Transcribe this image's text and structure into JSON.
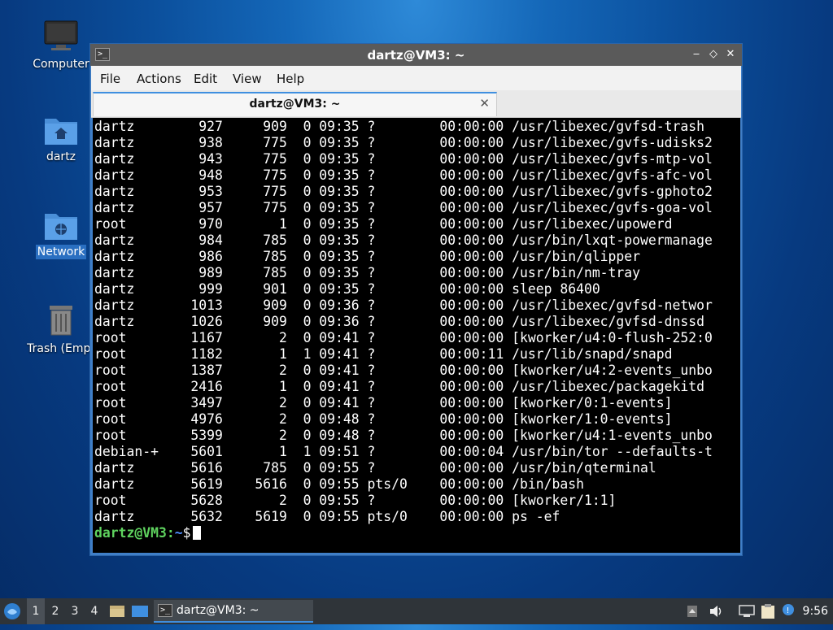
{
  "desktop": {
    "icons": [
      {
        "label": "Computer",
        "selected": false
      },
      {
        "label": "dartz",
        "selected": false
      },
      {
        "label": "Network",
        "selected": true
      },
      {
        "label": "Trash (Empt",
        "selected": false
      }
    ]
  },
  "window": {
    "title": "dartz@VM3: ~",
    "menu": [
      "File",
      "Actions",
      "Edit",
      "View",
      "Help"
    ],
    "tab_label": "dartz@VM3: ~",
    "tab_close": "✕",
    "controls": {
      "minimize": "‒",
      "maximize": "◇",
      "close": "✕"
    }
  },
  "terminal": {
    "lines": [
      "dartz        927     909  0 09:35 ?        00:00:00 /usr/libexec/gvfsd-trash",
      "dartz        938     775  0 09:35 ?        00:00:00 /usr/libexec/gvfs-udisks2",
      "dartz        943     775  0 09:35 ?        00:00:00 /usr/libexec/gvfs-mtp-vol",
      "dartz        948     775  0 09:35 ?        00:00:00 /usr/libexec/gvfs-afc-vol",
      "dartz        953     775  0 09:35 ?        00:00:00 /usr/libexec/gvfs-gphoto2",
      "dartz        957     775  0 09:35 ?        00:00:00 /usr/libexec/gvfs-goa-vol",
      "root         970       1  0 09:35 ?        00:00:00 /usr/libexec/upowerd",
      "dartz        984     785  0 09:35 ?        00:00:00 /usr/bin/lxqt-powermanage",
      "dartz        986     785  0 09:35 ?        00:00:00 /usr/bin/qlipper",
      "dartz        989     785  0 09:35 ?        00:00:00 /usr/bin/nm-tray",
      "dartz        999     901  0 09:35 ?        00:00:00 sleep 86400",
      "dartz       1013     909  0 09:36 ?        00:00:00 /usr/libexec/gvfsd-networ",
      "dartz       1026     909  0 09:36 ?        00:00:00 /usr/libexec/gvfsd-dnssd",
      "root        1167       2  0 09:41 ?        00:00:00 [kworker/u4:0-flush-252:0",
      "root        1182       1  1 09:41 ?        00:00:11 /usr/lib/snapd/snapd",
      "root        1387       2  0 09:41 ?        00:00:00 [kworker/u4:2-events_unbo",
      "root        2416       1  0 09:41 ?        00:00:00 /usr/libexec/packagekitd",
      "root        3497       2  0 09:41 ?        00:00:00 [kworker/0:1-events]",
      "root        4976       2  0 09:48 ?        00:00:00 [kworker/1:0-events]",
      "root        5399       2  0 09:48 ?        00:00:00 [kworker/u4:1-events_unbo",
      "debian-+    5601       1  1 09:51 ?        00:00:04 /usr/bin/tor --defaults-t",
      "dartz       5616     785  0 09:55 ?        00:00:00 /usr/bin/qterminal",
      "dartz       5619    5616  0 09:55 pts/0    00:00:00 /bin/bash",
      "root        5628       2  0 09:55 ?        00:00:00 [kworker/1:1]",
      "dartz       5632    5619  0 09:55 pts/0    00:00:00 ps -ef"
    ],
    "prompt_user": "dartz@VM3",
    "prompt_sep": ":",
    "prompt_path": "~",
    "prompt_end": "$",
    "colors": {
      "user": "#5fd35f",
      "path": "#4f8fff",
      "background": "#000000"
    }
  },
  "taskbar": {
    "workspaces": [
      "1",
      "2",
      "3",
      "4"
    ],
    "active_workspace": "1",
    "task_label": "dartz@VM3: ~",
    "clock": "9:56",
    "tray_icons": [
      "up-arrow-icon",
      "volume-icon",
      "network-icon",
      "clipboard-icon",
      "notification-icon"
    ]
  }
}
